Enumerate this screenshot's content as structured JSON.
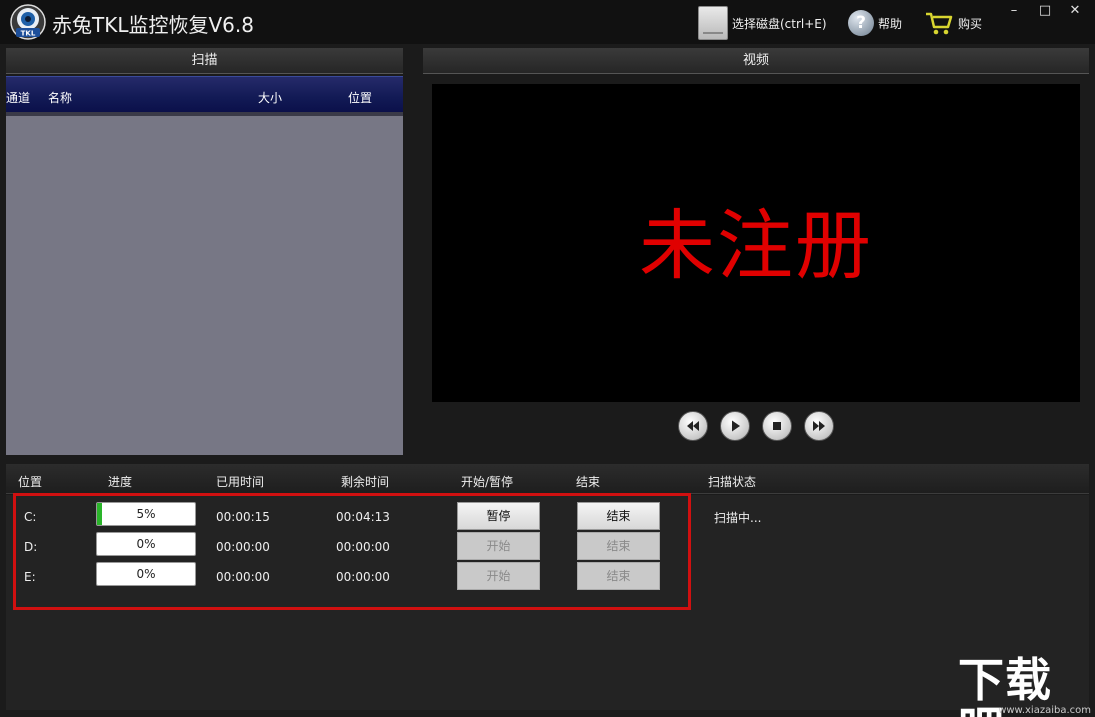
{
  "title": {
    "app_name": "赤兔TKL监控恢复V6.8",
    "logo_text": "TKL"
  },
  "toolbar": {
    "select_disk": "选择磁盘(ctrl+E)",
    "help": "帮助",
    "buy": "购买"
  },
  "window_controls": {
    "minimize": "–",
    "maximize": "□",
    "close": "✕"
  },
  "scan_panel": {
    "title": "扫描",
    "columns": [
      "通道",
      "名称",
      "大小",
      "位置"
    ]
  },
  "video_panel": {
    "title": "视频",
    "watermark": "未注册"
  },
  "tasks": {
    "columns": [
      "位置",
      "进度",
      "已用时间",
      "剩余时间",
      "开始/暂停",
      "结束",
      "扫描状态"
    ],
    "rows": [
      {
        "drive": "C:",
        "progress_label": "5%",
        "progress": 0.05,
        "elapsed": "00:00:15",
        "remaining": "00:04:13",
        "start_pause": "暂停",
        "end": "结束",
        "enabled": true
      },
      {
        "drive": "D:",
        "progress_label": "0%",
        "progress": 0,
        "elapsed": "00:00:00",
        "remaining": "00:00:00",
        "start_pause": "开始",
        "end": "结束",
        "enabled": false
      },
      {
        "drive": "E:",
        "progress_label": "0%",
        "progress": 0,
        "elapsed": "00:00:00",
        "remaining": "00:00:00",
        "start_pause": "开始",
        "end": "结束",
        "enabled": false
      }
    ],
    "status": "扫描中..."
  },
  "watermark_site": {
    "logo": "下载吧",
    "url": "www.xiazaiba.com"
  },
  "colors": {
    "accent_red": "#e00000",
    "frame_red": "#d01010",
    "progress_green": "#2ab42a"
  }
}
